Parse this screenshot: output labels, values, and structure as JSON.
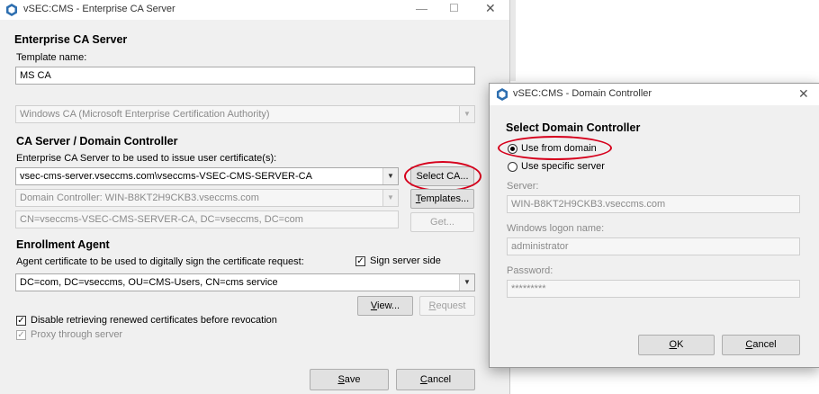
{
  "main_window": {
    "title": "vSEC:CMS - Enterprise CA Server",
    "heading": "Enterprise CA Server",
    "template_name_label": "Template name:",
    "template_name_value": "MS CA",
    "ca_type_value": "Windows CA (Microsoft Enterprise Certification Authority)",
    "ca_section_heading": "CA Server / Domain Controller",
    "ca_server_label": "Enterprise CA Server to be used to issue user certificate(s):",
    "ca_server_value": "vsec-cms-server.vseccms.com\\vseccms-VSEC-CMS-SERVER-CA",
    "select_ca_button": "Select CA...",
    "domain_controller_value": "Domain Controller: WIN-B8KT2H9CKB3.vseccms.com",
    "templates_button": "Templates...",
    "ca_dn_value": "CN=vseccms-VSEC-CMS-SERVER-CA, DC=vseccms, DC=com",
    "get_button": "Get...",
    "enrollment_heading": "Enrollment Agent",
    "agent_cert_label": "Agent certificate to be used to digitally sign the certificate request:",
    "sign_server_side_label": "Sign server side",
    "sign_server_side_checked": true,
    "agent_cert_value": "DC=com, DC=vseccms, OU=CMS-Users, CN=cms service",
    "view_button": "View...",
    "request_button": "Request",
    "disable_retrieving_label": "Disable retrieving renewed certificates before revocation",
    "disable_retrieving_checked": true,
    "proxy_label": "Proxy through server",
    "proxy_checked": true,
    "save_button": "Save",
    "cancel_button": "Cancel"
  },
  "dialog": {
    "title": "vSEC:CMS - Domain Controller",
    "heading": "Select Domain Controller",
    "options": [
      "Use from domain",
      "Use specific server"
    ],
    "selected_option": "Use from domain",
    "server_label": "Server:",
    "server_value": "WIN-B8KT2H9CKB3.vseccms.com",
    "logon_label": "Windows logon name:",
    "logon_value": "administrator",
    "password_label": "Password:",
    "password_value": "*********",
    "ok_button": "OK",
    "cancel_button": "Cancel"
  },
  "colors": {
    "highlight_circle": "#d6001c",
    "window_bg": "#f0f0f0"
  },
  "icons": {
    "app": "vsec-cms-app-icon",
    "minimize": "minimize-icon",
    "maximize": "maximize-icon",
    "close": "close-icon"
  }
}
